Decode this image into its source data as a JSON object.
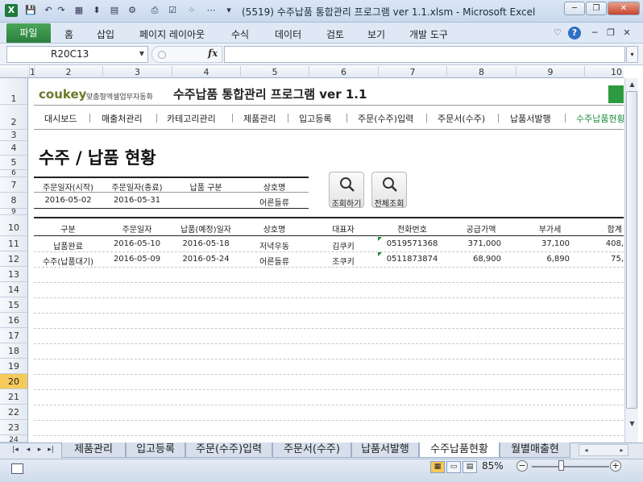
{
  "window": {
    "title": "(5519) 수주납품 통합관리 프로그램 ver 1.1.xlsm  -  Microsoft Excel",
    "minimize": "─",
    "restore": "❐",
    "close": "✕"
  },
  "ribbon": {
    "file_tab": "파일",
    "tabs": [
      "홈",
      "삽입",
      "페이지 레이아웃",
      "수식",
      "데이터",
      "검토",
      "보기",
      "개발 도구"
    ],
    "help": "?"
  },
  "formula_bar": {
    "name_box": "R20C13",
    "fx": "fx",
    "formula": ""
  },
  "columns": [
    "1",
    "2",
    "3",
    "4",
    "5",
    "6",
    "7",
    "8",
    "9",
    "10"
  ],
  "rows": [
    "1",
    "2",
    "3",
    "4",
    "5",
    "6",
    "7",
    "8",
    "9",
    "10",
    "11",
    "12",
    "13",
    "14",
    "15",
    "16",
    "17",
    "18",
    "19",
    "20",
    "21",
    "22",
    "23",
    "24"
  ],
  "selected_row": "20",
  "header": {
    "logo_text": "coukey",
    "logo_sub": "맞춤형엑셀업무자동화",
    "app_title": "수주납품 통합관리 프로그램 ver 1.1"
  },
  "nav": [
    "대시보드",
    "매출처관리",
    "카테고리관리",
    "제품관리",
    "입고등록",
    "주문(수주)입력",
    "주문서(수주)",
    "납품서발행",
    "수주납품현황"
  ],
  "page_title": "수주 / 납품 현황",
  "filter": {
    "headers": [
      "주문일자(시작)",
      "주문일자(종료)",
      "납품 구분",
      "상호명"
    ],
    "values": [
      "2016-05-02",
      "2016-05-31",
      "",
      "어른들류"
    ]
  },
  "buttons": {
    "search": "조회하기",
    "search_all": "전체조회"
  },
  "table": {
    "headers": [
      "구분",
      "주문일자",
      "납품(예정)일자",
      "상호명",
      "대표자",
      "전화번호",
      "공급가액",
      "부가세",
      "합계"
    ],
    "rows": [
      [
        "납품완료",
        "2016-05-10",
        "2016-05-18",
        "저녁우동",
        "김쿠키",
        "0519571368",
        "371,000",
        "37,100",
        "408,"
      ],
      [
        "수주(납품대기)",
        "2016-05-09",
        "2016-05-24",
        "어른들류",
        "조쿠키",
        "0511873874",
        "68,900",
        "6,890",
        "75,"
      ]
    ]
  },
  "sheet_tabs": [
    "제품관리",
    "입고등록",
    "주문(수주)입력",
    "주문서(수주)",
    "납품서발행",
    "수주납품현황",
    "월별매출현"
  ],
  "active_sheet": "수주납품현황",
  "status": {
    "zoom": "85%"
  },
  "colors": {
    "accent_green": "#1a8a3a",
    "file_tab": "#2c7f3b",
    "selected_row": "#f5c95a"
  }
}
